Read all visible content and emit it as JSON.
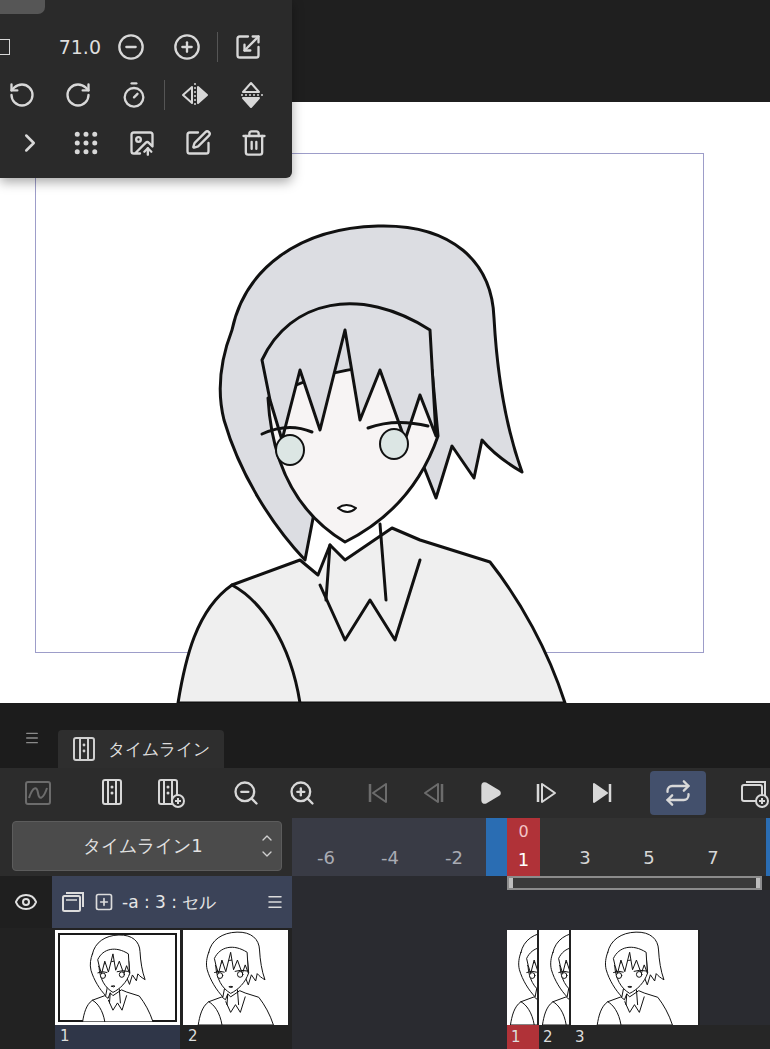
{
  "tool_panel": {
    "checkbox": {
      "checked": false
    },
    "value": "71.0"
  },
  "timeline": {
    "tab": {
      "label": "タイムライン",
      "selected": true
    },
    "toolbar": [
      [
        {
          "kind": "graph",
          "disabled": true,
          "selected": false
        }
      ],
      [
        {
          "kind": "track",
          "disabled": false,
          "selected": false
        },
        {
          "kind": "track-add",
          "disabled": false,
          "selected": false
        }
      ],
      [
        {
          "kind": "zoom-out",
          "disabled": false,
          "selected": false
        },
        {
          "kind": "zoom-in",
          "disabled": false,
          "selected": false
        }
      ],
      [
        {
          "kind": "first",
          "disabled": true,
          "selected": false
        },
        {
          "kind": "prev",
          "disabled": true,
          "selected": false
        },
        {
          "kind": "play",
          "disabled": false,
          "selected": false
        },
        {
          "kind": "next",
          "disabled": false,
          "selected": false
        },
        {
          "kind": "last",
          "disabled": false,
          "selected": false
        }
      ],
      [
        {
          "kind": "loop",
          "disabled": false,
          "selected": true
        }
      ],
      [
        {
          "kind": "new-timeline",
          "disabled": false,
          "selected": false
        }
      ]
    ],
    "name": "タイムライン1",
    "ruler": {
      "pre_ticks": [
        "-6",
        "-4",
        "-2"
      ],
      "playhead": {
        "current": "0",
        "frame": "1"
      },
      "ticks": [
        "3",
        "5",
        "7"
      ]
    },
    "layer": {
      "name": "-a : 3 : セル",
      "visible": true
    },
    "cells": [
      {
        "label": "1",
        "selected": true
      },
      {
        "label": "2",
        "selected": false
      }
    ],
    "frames": [
      "1",
      "2",
      "3"
    ]
  }
}
